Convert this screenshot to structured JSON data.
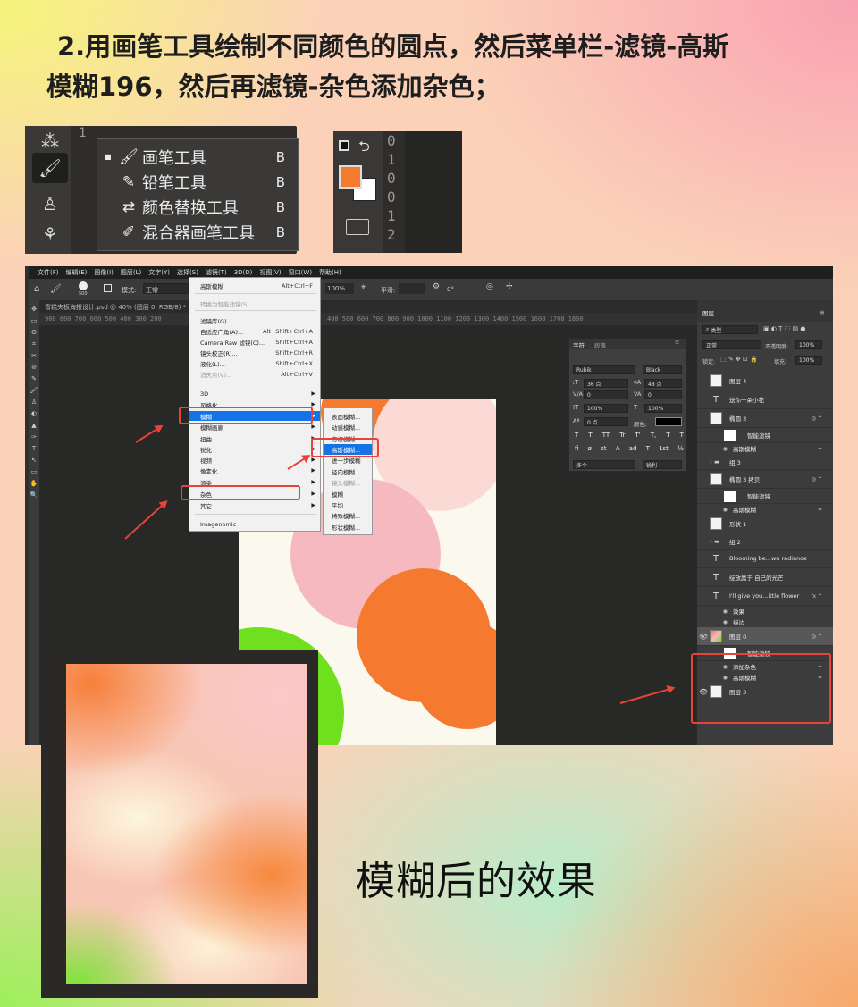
{
  "heading": {
    "line1": "2.用画笔工具绘制不同颜色的圆点，然后菜单栏-滤镜-高斯",
    "line2": "模糊196，然后再滤镜-杂色添加杂色；"
  },
  "brush_panel": {
    "ruler_num": "1",
    "items": [
      {
        "label": "画笔工具",
        "key": "B"
      },
      {
        "label": "铅笔工具",
        "key": "B"
      },
      {
        "label": "颜色替换工具",
        "key": "B"
      },
      {
        "label": "混合器画笔工具",
        "key": "B"
      }
    ]
  },
  "swatch_panel": {
    "fg_color": "#f57a30",
    "bg_color": "#ffffff",
    "ruler": [
      "0",
      "1",
      "0",
      "0",
      "1",
      "2"
    ]
  },
  "ps": {
    "menubar": [
      "文件(F)",
      "编辑(E)",
      "图像(I)",
      "图层(L)",
      "文字(Y)",
      "选择(S)",
      "滤镜(T)",
      "3D(D)",
      "视图(V)",
      "窗口(W)",
      "帮助(H)"
    ],
    "options": {
      "size": "500",
      "mode_label": "模式:",
      "mode": "正常",
      "zoom": "100%",
      "smooth_label": "平滑:",
      "angle": "0°"
    },
    "doc_tab": "雪糕夹板海报设计.psd @ 40% (图层 0, RGB/8) *",
    "ruler_left": "900  800  700  600  500  400  300  200",
    "ruler_right": "400  500  600  700  800  900  1000  1100  1200  1300  1400  1500  1600  1700  1800",
    "filter_menu": [
      {
        "label": "高斯模糊",
        "key": "Alt+Ctrl+F"
      },
      {
        "label": "转换为智能滤镜(S)",
        "key": ""
      },
      {
        "label": "滤镜库(G)...",
        "key": ""
      },
      {
        "label": "自适应广角(A)...",
        "key": "Alt+Shift+Ctrl+A"
      },
      {
        "label": "Camera Raw 滤镜(C)...",
        "key": "Shift+Ctrl+A"
      },
      {
        "label": "镜头校正(R)...",
        "key": "Shift+Ctrl+R"
      },
      {
        "label": "液化(L)...",
        "key": "Shift+Ctrl+X"
      },
      {
        "label": "消失点(V)...",
        "key": "Alt+Ctrl+V"
      },
      {
        "label": "3D",
        "key": ""
      },
      {
        "label": "风格化",
        "key": ""
      },
      {
        "label": "模糊",
        "key": ""
      },
      {
        "label": "模糊画廊",
        "key": ""
      },
      {
        "label": "扭曲",
        "key": ""
      },
      {
        "label": "锐化",
        "key": ""
      },
      {
        "label": "视频",
        "key": ""
      },
      {
        "label": "像素化",
        "key": ""
      },
      {
        "label": "渲染",
        "key": ""
      },
      {
        "label": "杂色",
        "key": ""
      },
      {
        "label": "其它",
        "key": ""
      },
      {
        "label": "Imagenomic",
        "key": ""
      }
    ],
    "blur_menu": [
      "表面模糊...",
      "动感模糊...",
      "方框模糊...",
      "高斯模糊...",
      "进一步模糊",
      "径向模糊...",
      "镜头模糊...",
      "模糊",
      "平均",
      "特殊模糊...",
      "形状模糊..."
    ],
    "char_panel": {
      "tabs": [
        "字符",
        "段落"
      ],
      "font": "Rubik",
      "style": "Black",
      "size": "36 点",
      "leading": "48 点",
      "kerning_va": "0",
      "tracking": "0",
      "vscale": "100%",
      "hscale": "100%",
      "baseline": "0 点",
      "color_label": "颜色:",
      "lang": "多个",
      "aa": "锐利",
      "type_buttons": [
        "T",
        "T",
        "TT",
        "Tr",
        "T'",
        "T,",
        "T",
        "T"
      ],
      "ot_buttons": [
        "fi",
        "ø",
        "st",
        "A",
        "ad",
        "T",
        "1st",
        "½"
      ]
    },
    "layers_panel": {
      "tab": "图层",
      "filter_kind": "类型",
      "blend": "正常",
      "opacity_label": "不透明度:",
      "opacity": "100%",
      "lock_label": "锁定:",
      "fill_label": "填充:",
      "fill": "100%",
      "rows": [
        {
          "name": "图层 4",
          "kind": "img",
          "fx": ""
        },
        {
          "name": "送你一朵小花",
          "kind": "text",
          "fx": ""
        },
        {
          "name": "椭圆 3",
          "kind": "img",
          "fx": "◎ ^"
        },
        {
          "name": "智能滤镜",
          "kind": "sub",
          "fx": ""
        },
        {
          "name": "高斯模糊",
          "kind": "subeye",
          "fx": "≑"
        },
        {
          "name": "组 3",
          "kind": "group",
          "fx": ""
        },
        {
          "name": "椭圆 3 拷贝",
          "kind": "img",
          "fx": "◎ ^"
        },
        {
          "name": "智能滤镜",
          "kind": "sub",
          "fx": ""
        },
        {
          "name": "高斯模糊",
          "kind": "subeye",
          "fx": "≑"
        },
        {
          "name": "形状 1",
          "kind": "img",
          "fx": ""
        },
        {
          "name": "组 2",
          "kind": "group",
          "fx": ""
        },
        {
          "name": "Blooming be...wn radiance",
          "kind": "text",
          "fx": ""
        },
        {
          "name": "绽放属于 自己的光芒",
          "kind": "text",
          "fx": ""
        },
        {
          "name": "I'll give you...ittle flower",
          "kind": "text",
          "fx": "fx ^"
        },
        {
          "name": "效果",
          "kind": "subeye",
          "fx": ""
        },
        {
          "name": "描边",
          "kind": "subeye",
          "fx": ""
        },
        {
          "name": "图层 0",
          "kind": "sel",
          "fx": "◎ ^"
        },
        {
          "name": "智能滤镜",
          "kind": "sub",
          "fx": ""
        },
        {
          "name": "添加杂色",
          "kind": "subeye",
          "fx": "≑"
        },
        {
          "name": "高斯模糊",
          "kind": "subeye",
          "fx": "≑"
        },
        {
          "name": "图层 3",
          "kind": "img",
          "fx": ""
        }
      ]
    }
  },
  "caption": "模糊后的效果",
  "colors": {
    "accent_red": "#e8433a",
    "menu_highlight": "#1473e6",
    "orange": "#f57a30",
    "pink": "#f7b9c0",
    "green": "#6fe01e"
  }
}
